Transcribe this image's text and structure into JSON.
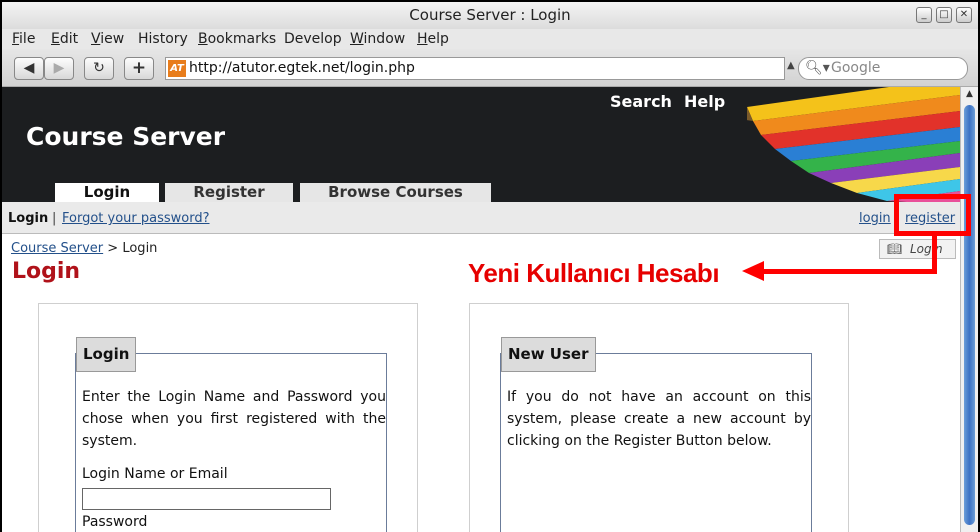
{
  "window": {
    "title": "Course Server : Login"
  },
  "menu": [
    {
      "label": "File",
      "u": "F",
      "rest": "ile"
    },
    {
      "label": "Edit",
      "u": "E",
      "rest": "dit"
    },
    {
      "label": "View",
      "u": "V",
      "rest": "iew"
    },
    {
      "label": "History",
      "u": "",
      "rest": "History"
    },
    {
      "label": "Bookmarks",
      "u": "B",
      "rest": "ookmarks"
    },
    {
      "label": "Develop",
      "u": "",
      "rest": "Develop"
    },
    {
      "label": "Window",
      "u": "W",
      "rest": "indow"
    },
    {
      "label": "Help",
      "u": "H",
      "rest": "elp"
    }
  ],
  "toolbar": {
    "back": "◀",
    "forward": "▶",
    "reload": "↻",
    "new_tab": "+",
    "favicon": "AT",
    "url": "http://atutor.egtek.net/login.php",
    "search_placeholder": "Google"
  },
  "site": {
    "title": "Course Server",
    "top_links": [
      "Search",
      "Help"
    ],
    "tabs": [
      "Login",
      "Register",
      "Browse Courses"
    ]
  },
  "subnav": {
    "current": "Login",
    "separator": "|",
    "forgot": "Forgot your password?",
    "right_links": [
      "login",
      "register"
    ]
  },
  "breadcrumb": {
    "home": "Course Server",
    "sep": ">",
    "current": "Login"
  },
  "login_button": "Login",
  "page_title": "Login",
  "login_panel": {
    "legend": "Login",
    "text": "Enter the Login Name and Password you chose when you first registered with the system.",
    "field1_label": "Login Name or Email",
    "field2_label": "Password"
  },
  "new_user_panel": {
    "legend": "New User",
    "text": "If you do not have an account on this system, please create a new account by clicking on the Register Button below."
  },
  "annotation": {
    "text": "Yeni Kullanıcı Hesabı",
    "color": "#ff0000"
  }
}
